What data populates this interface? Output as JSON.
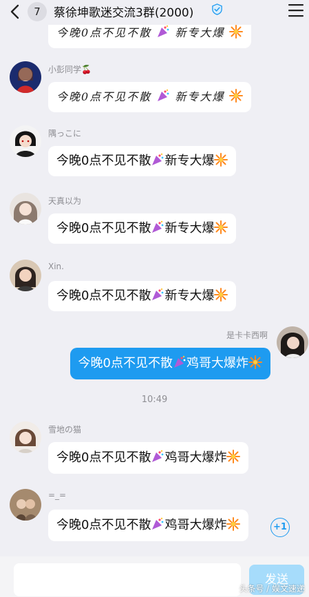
{
  "header": {
    "back_icon": "chevron-left-icon",
    "unread_count": "7",
    "title": "蔡徐坤歌迷交流3群(2000)",
    "verified_icon": "verified-shield-icon",
    "menu_icon": "hamburger-menu-icon"
  },
  "messages": [
    {
      "sender": "",
      "text": "今晚0点不见不散",
      "suffix": "新专大爆",
      "style": "script"
    },
    {
      "sender": "小彭同学🍒",
      "text": "今晚0点不见不散",
      "suffix": "新专大爆",
      "style": "script"
    },
    {
      "sender": "隅っこに",
      "text": "今晚0点不见不散",
      "suffix": "新专大爆",
      "style": "normal"
    },
    {
      "sender": "天真以为",
      "text": "今晚0点不见不散",
      "suffix": "新专大爆",
      "style": "normal"
    },
    {
      "sender": "Xin.",
      "text": "今晚0点不见不散",
      "suffix": "新专大爆",
      "style": "normal"
    },
    {
      "sender": "是卡卡西啊",
      "text": "今晚0点不见不散",
      "suffix": "鸡哥大爆炸",
      "style": "mine"
    },
    {
      "sender": "雪地の猫",
      "text": "今晚0点不见不散",
      "suffix": "鸡哥大爆炸",
      "style": "normal"
    },
    {
      "sender": "=_=",
      "text": "今晚0点不见不散",
      "suffix": "鸡哥大爆炸",
      "style": "normal"
    }
  ],
  "timestamp": "10:49",
  "plus_one": "+1",
  "input": {
    "placeholder": ""
  },
  "send_label": "发送",
  "watermark": "头条号 / 娱文速递",
  "colors": {
    "accent": "#1e9bf0",
    "background": "#efeff4",
    "send_disabled": "#a6dcfb"
  },
  "icons": {
    "party_popper": "party-popper-emoji-icon",
    "firework": "firework-emoji-icon"
  }
}
